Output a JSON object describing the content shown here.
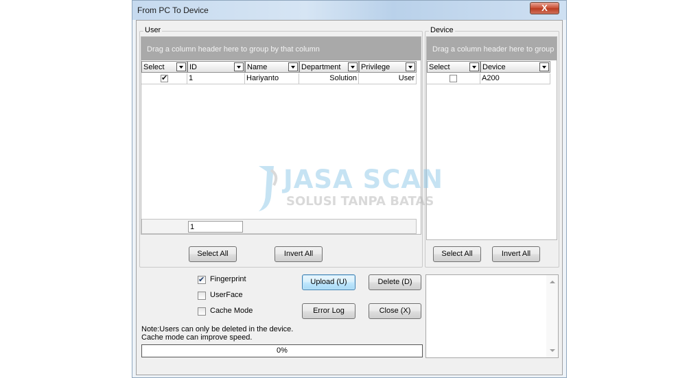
{
  "window": {
    "title": "From PC To Device",
    "close_label": "X"
  },
  "user_group": {
    "label": "User",
    "group_panel_text": "Drag a column header here to group by that column",
    "columns": [
      "Select",
      "ID",
      "Name",
      "Department",
      "Privilege"
    ],
    "rows": [
      {
        "selected": true,
        "id": "1",
        "name": "Hariyanto",
        "department": "Solution",
        "privilege": "User"
      }
    ],
    "footer_count": "1",
    "select_all_label": "Select All",
    "invert_all_label": "Invert All"
  },
  "device_group": {
    "label": "Device",
    "group_panel_text": "Drag a column header here to group by that column",
    "columns": [
      "Select",
      "Device"
    ],
    "rows": [
      {
        "selected": false,
        "device": "A200"
      }
    ],
    "select_all_label": "Select All",
    "invert_all_label": "Invert All"
  },
  "options": {
    "fingerprint": {
      "label": "Fingerprint",
      "checked": true
    },
    "userface": {
      "label": "UserFace",
      "checked": false
    },
    "cache_mode": {
      "label": "Cache Mode",
      "checked": false
    }
  },
  "buttons": {
    "upload": "Upload (U)",
    "delete": "Delete (D)",
    "error_log": "Error Log",
    "close": "Close (X)"
  },
  "notes": {
    "line1": "Note:Users can only be deleted in the device.",
    "line2": "Cache mode can improve speed."
  },
  "progress": {
    "text": "0%",
    "value": 0
  },
  "watermark": {
    "line1": "JASA SCAN",
    "line2": "SOLUSI TANPA BATAS"
  }
}
